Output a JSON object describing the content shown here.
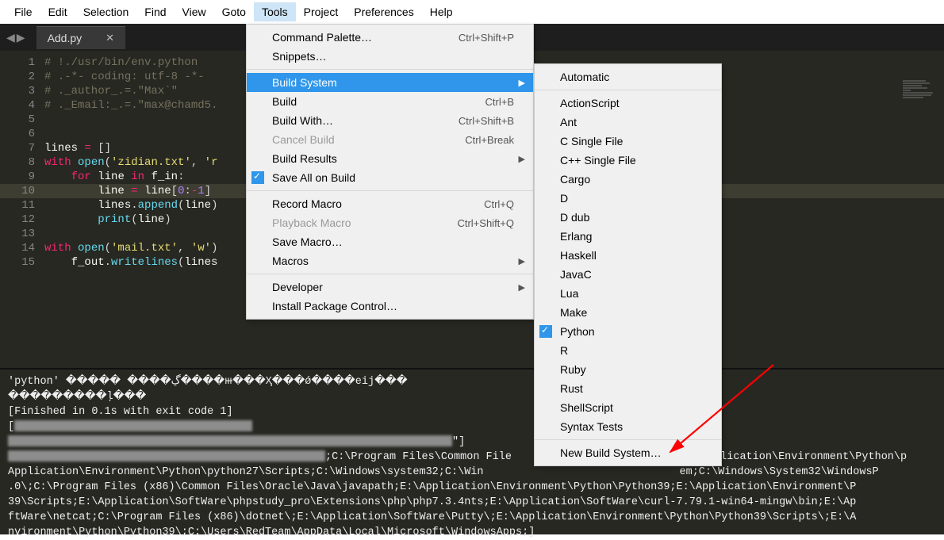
{
  "menubar": [
    "File",
    "Edit",
    "Selection",
    "Find",
    "View",
    "Goto",
    "Tools",
    "Project",
    "Preferences",
    "Help"
  ],
  "menubar_active": "Tools",
  "tab": {
    "name": "Add.py"
  },
  "code_lines": [
    {
      "n": 1,
      "html": "<span class='c-com'># !./usr/bin/env.python</span>"
    },
    {
      "n": 2,
      "html": "<span class='c-com'># .-*- coding: utf-8 -*-</span>"
    },
    {
      "n": 3,
      "html": "<span class='c-com'># ._author_.=.\"Max`\"</span>"
    },
    {
      "n": 4,
      "html": "<span class='c-com'># ._Email:_.=.\"max@chamd5.</span>"
    },
    {
      "n": 5,
      "html": ""
    },
    {
      "n": 6,
      "html": ""
    },
    {
      "n": 7,
      "html": "<span class='c-id'>lines</span> <span class='c-kw'>=</span> []"
    },
    {
      "n": 8,
      "html": "<span class='c-kw'>with</span> <span class='c-fn'>open</span>(<span class='c-str'>'zidian.txt'</span>, <span class='c-str'>'r</span>"
    },
    {
      "n": 9,
      "html": "    <span class='c-kw'>for</span> <span class='c-id'>line</span> <span class='c-kw'>in</span> <span class='c-id'>f_in</span>:"
    },
    {
      "n": 10,
      "html": "        <span class='c-id'>line</span> <span class='c-kw'>=</span> <span class='c-id'>line</span>[<span class='c-num'>0</span>:<span class='c-kw'>-</span><span class='c-num'>1</span>] "
    },
    {
      "n": 11,
      "html": "        <span class='c-id'>lines</span>.<span class='c-fn'>append</span>(<span class='c-id'>line</span>)"
    },
    {
      "n": 12,
      "html": "        <span class='c-fn'>print</span>(<span class='c-id'>line</span>)"
    },
    {
      "n": 13,
      "html": ""
    },
    {
      "n": 14,
      "html": "<span class='c-kw'>with</span> <span class='c-fn'>open</span>(<span class='c-str'>'mail.txt'</span>, <span class='c-str'>'w'</span>)"
    },
    {
      "n": 15,
      "html": "    <span class='c-id'>f_out</span>.<span class='c-fn'>writelines</span>(<span class='c-id'>lines</span>"
    }
  ],
  "tools_menu": [
    {
      "label": "Command Palette…",
      "shortcut": "Ctrl+Shift+P"
    },
    {
      "label": "Snippets…"
    },
    {
      "sep": true
    },
    {
      "label": "Build System",
      "submenu": true,
      "hl": true
    },
    {
      "label": "Build",
      "shortcut": "Ctrl+B"
    },
    {
      "label": "Build With…",
      "shortcut": "Ctrl+Shift+B"
    },
    {
      "label": "Cancel Build",
      "shortcut": "Ctrl+Break",
      "disabled": true
    },
    {
      "label": "Build Results",
      "submenu": true
    },
    {
      "label": "Save All on Build",
      "checked": true
    },
    {
      "sep": true
    },
    {
      "label": "Record Macro",
      "shortcut": "Ctrl+Q"
    },
    {
      "label": "Playback Macro",
      "shortcut": "Ctrl+Shift+Q",
      "disabled": true
    },
    {
      "label": "Save Macro…"
    },
    {
      "label": "Macros",
      "submenu": true
    },
    {
      "sep": true
    },
    {
      "label": "Developer",
      "submenu": true
    },
    {
      "label": "Install Package Control…"
    }
  ],
  "build_systems": [
    {
      "label": "Automatic"
    },
    {
      "sep": true
    },
    {
      "label": "ActionScript"
    },
    {
      "label": "Ant"
    },
    {
      "label": "C Single File"
    },
    {
      "label": "C++ Single File"
    },
    {
      "label": "Cargo"
    },
    {
      "label": "D"
    },
    {
      "label": "D dub"
    },
    {
      "label": "Erlang"
    },
    {
      "label": "Haskell"
    },
    {
      "label": "JavaC"
    },
    {
      "label": "Lua"
    },
    {
      "label": "Make"
    },
    {
      "label": "Python",
      "checked": true
    },
    {
      "label": "R"
    },
    {
      "label": "Ruby"
    },
    {
      "label": "Rust"
    },
    {
      "label": "ShellScript"
    },
    {
      "label": "Syntax Tests"
    },
    {
      "sep": true
    },
    {
      "label": "New Build System…"
    }
  ],
  "console": {
    "l1": "'python' ����� ����ڲ����ⲿ���Ҳ���ǿ����еij���",
    "l2": "���������ļ���",
    "l3": "[Finished in 0.1s with exit code 1]",
    "l4_tail": "\"]",
    "path1": ";C:\\Program Files\\Common File",
    "path1b": "pplication\\Environment\\Python\\p",
    "path2": "Application\\Environment\\Python\\python27\\Scripts;C:\\Windows\\system32;C:\\Win",
    "path2b": "em;C:\\Windows\\System32\\WindowsP",
    "path3": ".0\\;C:\\Program Files (x86)\\Common Files\\Oracle\\Java\\javapath;E:\\Application\\Environment\\Python\\Python39;E:\\Application\\Environment\\P",
    "path4": "39\\Scripts;E:\\Application\\SoftWare\\phpstudy_pro\\Extensions\\php\\php7.3.4nts;E:\\Application\\SoftWare\\curl-7.79.1-win64-mingw\\bin;E:\\Ap",
    "path5": "ftWare\\netcat;C:\\Program Files (x86)\\dotnet\\;E:\\Application\\SoftWare\\Putty\\;E:\\Application\\Environment\\Python\\Python39\\Scripts\\;E:\\A",
    "path6": "nvironment\\Python\\Python39\\;C:\\Users\\RedTeam\\AppData\\Local\\Microsoft\\WindowsApps;]"
  }
}
